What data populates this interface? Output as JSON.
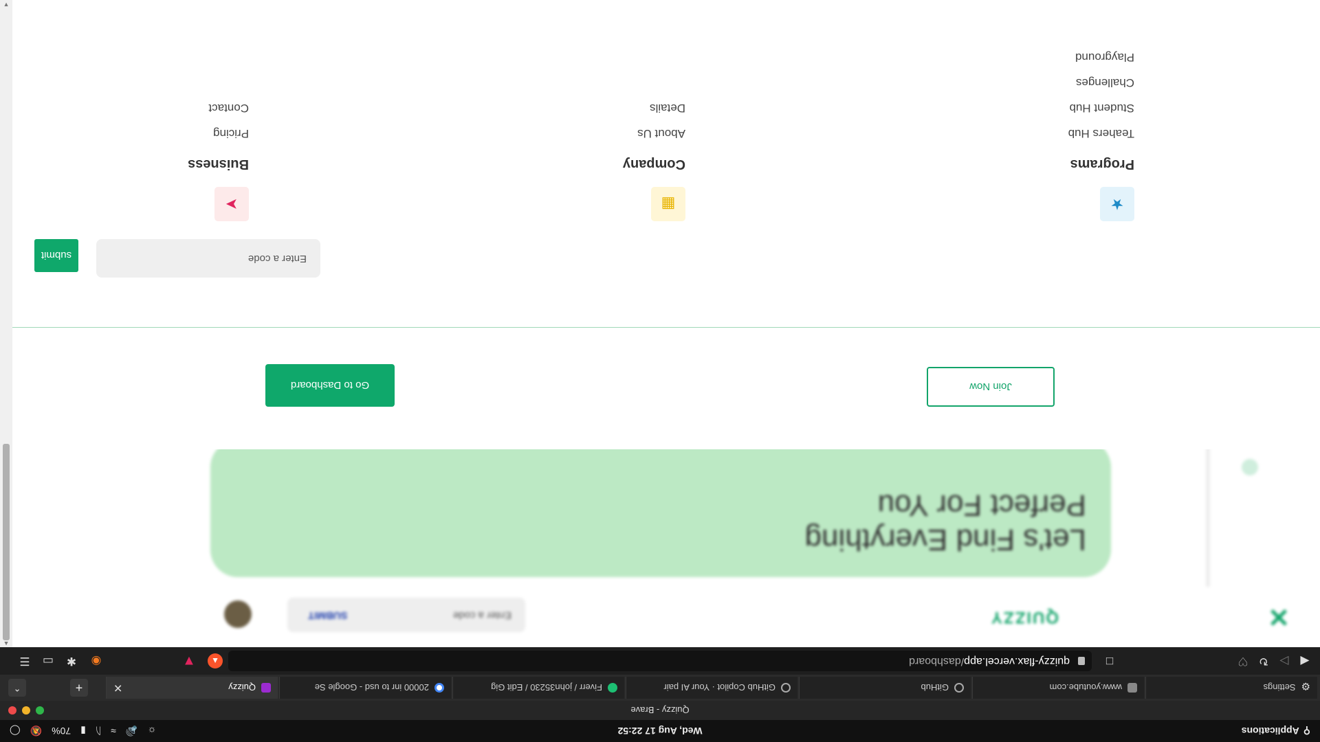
{
  "os": {
    "applications": "Applications",
    "clock": "Wed, Aug 17   22:52",
    "battery": "70%"
  },
  "window": {
    "title": "Quizzy - Brave"
  },
  "tabs": [
    {
      "label": "Settings",
      "icon": "gear-icon"
    },
    {
      "label": "www.youtube.com",
      "icon": "youtube-icon"
    },
    {
      "label": "GitHub",
      "icon": "github-icon"
    },
    {
      "label": "GitHub Copilot · Your AI pair",
      "icon": "github-icon"
    },
    {
      "label": "Fiverr / john35230 / Edit Gig",
      "icon": "fiverr-icon"
    },
    {
      "label": "20000 inr to usd - Google Se",
      "icon": "google-icon"
    },
    {
      "label": "Quizzy",
      "icon": "quizzy-icon",
      "active": true
    }
  ],
  "toolbar": {
    "url_host": "quizzy-flax.vercel.app",
    "url_path": "/dashboard"
  },
  "site": {
    "brand": "QUIZZY",
    "nav_code_placeholder": "Enter  a code",
    "nav_submit": "SUBMIT",
    "hero_text_line1": "Let's Find Everything",
    "hero_text_line2": "Perfect For You"
  },
  "menu": {
    "join_label": "Join Now",
    "dashboard_label": "Go to Dashboard",
    "code_placeholder": "Enter a code",
    "code_submit": "submit",
    "columns": [
      {
        "heading": "Programs",
        "icon": "bulb-icon",
        "links": [
          "Teahers Hub",
          "Student Hub",
          "Challenges",
          "Playground"
        ]
      },
      {
        "heading": "Company",
        "icon": "building-icon",
        "links": [
          "About Us",
          "Details"
        ]
      },
      {
        "heading": "Buisness",
        "icon": "rocket-icon",
        "links": [
          "Pricing",
          "Contact"
        ]
      }
    ]
  },
  "colors": {
    "brand_green": "#0fa86b",
    "hero_green": "#bce9c4",
    "link_blue": "#1f3fae"
  }
}
